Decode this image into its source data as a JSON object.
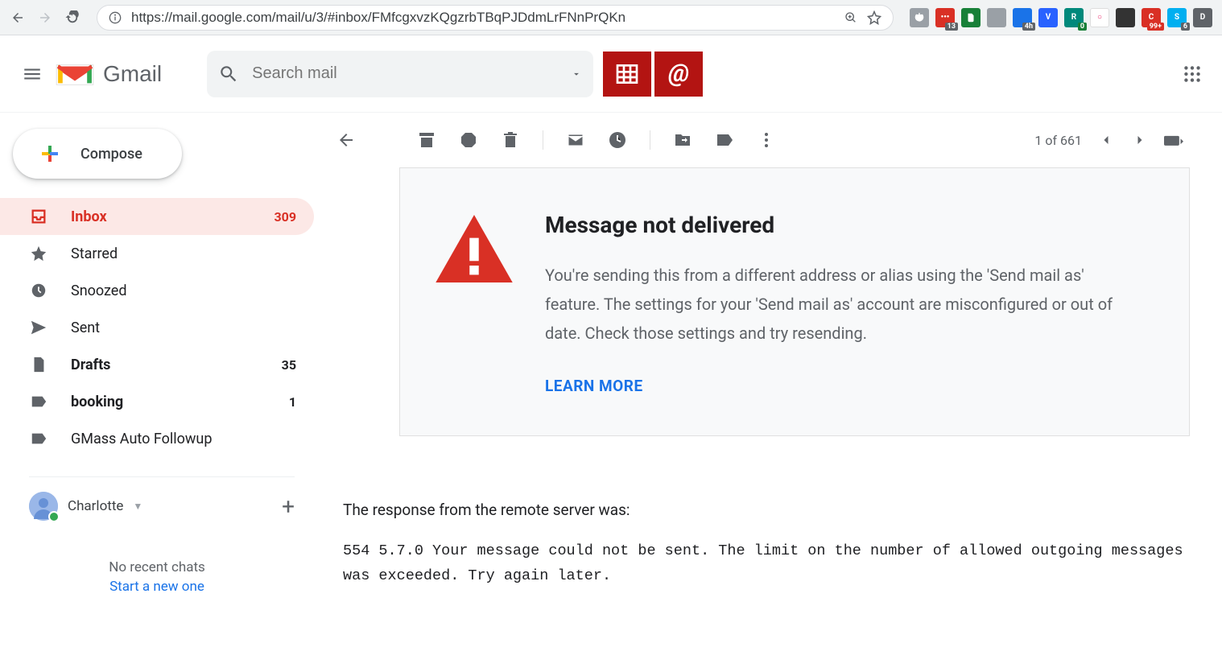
{
  "browser": {
    "url": "https://mail.google.com/mail/u/3/#inbox/FMfcgxvzKQgzrbTBqPJDdmLrFNnPrQKn",
    "ext_badges": {
      "lp": "13",
      "todo": "4h",
      "r": "0",
      "s": "99+",
      "g": "6"
    }
  },
  "header": {
    "logo": "Gmail",
    "search_placeholder": "Search mail"
  },
  "compose": {
    "label": "Compose"
  },
  "sidebar": {
    "items": [
      {
        "icon": "inbox",
        "label": "Inbox",
        "count": "309",
        "active": true
      },
      {
        "icon": "star",
        "label": "Starred"
      },
      {
        "icon": "clock",
        "label": "Snoozed"
      },
      {
        "icon": "send",
        "label": "Sent"
      },
      {
        "icon": "file",
        "label": "Drafts",
        "count": "35",
        "bold": true
      },
      {
        "icon": "label",
        "label": "booking",
        "count": "1",
        "bold": true
      },
      {
        "icon": "label",
        "label": "GMass Auto Followup"
      }
    ]
  },
  "hangouts": {
    "name": "Charlotte",
    "no_chats": "No recent chats",
    "start": "Start a new one"
  },
  "toolbar": {
    "pager": "1 of 661"
  },
  "message": {
    "title": "Message not delivered",
    "body": "You're sending this from a different address or alias using the 'Send mail as' feature. The settings for your 'Send mail as' account are misconfigured or out of date. Check those settings and try resending.",
    "learn_more": "LEARN MORE"
  },
  "response": {
    "intro": "The response from the remote server was:",
    "code": "554 5.7.0 Your message could not be sent. The limit on the number of allowed outgoing messages was exceeded. Try again later."
  }
}
